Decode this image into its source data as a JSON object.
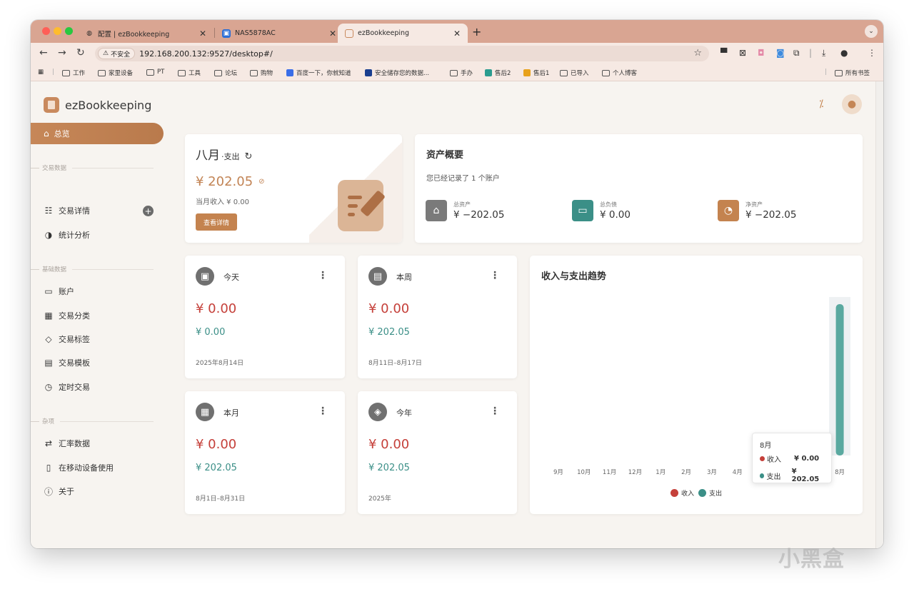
{
  "browser": {
    "tabs": [
      {
        "title": "配置 | ezBookkeeping",
        "active": false
      },
      {
        "title": "NAS5878AC",
        "active": false
      },
      {
        "title": "ezBookkeeping",
        "active": true
      }
    ],
    "security_label": "不安全",
    "url": "192.168.200.132:9527/desktop#/",
    "bookmarks": [
      "工作",
      "家里设备",
      "PT",
      "工具",
      "论坛",
      "购物",
      "百度一下，你就知道",
      "安全储存您的数据...",
      "手办",
      "售后2",
      "售后1",
      "已导入",
      "个人博客"
    ],
    "all_bookmarks": "所有书签",
    "colors": {
      "tabbar": "#d9a592",
      "toolbar": "#f6e9e3"
    }
  },
  "app": {
    "name": "ezBookkeeping",
    "colors": {
      "accent": "#c4834f",
      "expense": "#c5403a",
      "income": "#3b8f87"
    }
  },
  "sidebar": {
    "active": {
      "label": "总览",
      "icon": "home-icon"
    },
    "sections": [
      {
        "title": "交易数据",
        "items": [
          {
            "label": "交易详情",
            "icon": "list-icon"
          },
          {
            "label": "统计分析",
            "icon": "chart-pie-icon"
          }
        ]
      },
      {
        "title": "基础数据",
        "items": [
          {
            "label": "账户",
            "icon": "card-icon"
          },
          {
            "label": "交易分类",
            "icon": "category-icon"
          },
          {
            "label": "交易标签",
            "icon": "tag-icon"
          },
          {
            "label": "交易模板",
            "icon": "clipboard-icon"
          },
          {
            "label": "定时交易",
            "icon": "schedule-icon"
          }
        ]
      },
      {
        "title": "杂项",
        "items": [
          {
            "label": "汇率数据",
            "icon": "exchange-icon"
          },
          {
            "label": "在移动设备使用",
            "icon": "phone-icon"
          },
          {
            "label": "关于",
            "icon": "info-icon"
          }
        ]
      }
    ]
  },
  "overview": {
    "month": "八月",
    "type": "·支出",
    "amount": "¥ 202.05",
    "income_text": "当月收入 ¥ 0.00",
    "details_button": "查看详情"
  },
  "assets": {
    "title": "资产概要",
    "subtitle": "您已经记录了 1 个账户",
    "items": [
      {
        "label": "总资产",
        "value": "¥ −202.05",
        "color": "#7a7a7a",
        "icon": "bank-icon"
      },
      {
        "label": "总负债",
        "value": "¥ 0.00",
        "color": "#3b8f87",
        "icon": "card-icon"
      },
      {
        "label": "净资产",
        "value": "¥ −202.05",
        "color": "#c4834f",
        "icon": "piggy-bank-icon"
      }
    ]
  },
  "periods": [
    {
      "title": "今天",
      "expense": "¥ 0.00",
      "income": "¥ 0.00",
      "date": "2025年8月14日",
      "icon": "calendar-today-icon"
    },
    {
      "title": "本周",
      "expense": "¥ 0.00",
      "income": "¥ 202.05",
      "date": "8月11日–8月17日",
      "icon": "calendar-week-icon"
    },
    {
      "title": "本月",
      "expense": "¥ 0.00",
      "income": "¥ 202.05",
      "date": "8月1日–8月31日",
      "icon": "calendar-month-icon"
    },
    {
      "title": "今年",
      "expense": "¥ 0.00",
      "income": "¥ 202.05",
      "date": "2025年",
      "icon": "layers-icon"
    }
  ],
  "trend": {
    "title": "收入与支出趋势",
    "tooltip": {
      "month": "8月",
      "rows": [
        {
          "label": "收入",
          "value": "¥ 0.00"
        },
        {
          "label": "支出",
          "value": "¥ 202.05"
        }
      ]
    }
  },
  "chart_data": {
    "type": "bar",
    "categories": [
      "9月",
      "10月",
      "11月",
      "12月",
      "1月",
      "2月",
      "3月",
      "4月",
      "5月",
      "6月",
      "7月",
      "8月"
    ],
    "series": [
      {
        "name": "收入",
        "values": [
          0,
          0,
          0,
          0,
          0,
          0,
          0,
          0,
          0,
          0,
          0,
          0
        ],
        "color": "#c5403a"
      },
      {
        "name": "支出",
        "values": [
          0,
          0,
          0,
          0,
          0,
          0,
          0,
          0,
          0,
          0,
          0,
          202.05
        ],
        "color": "#5aa9a0"
      }
    ],
    "highlighted_category": "8月",
    "legend": "bottom-center",
    "grid": false
  },
  "watermark": "小黑盒"
}
